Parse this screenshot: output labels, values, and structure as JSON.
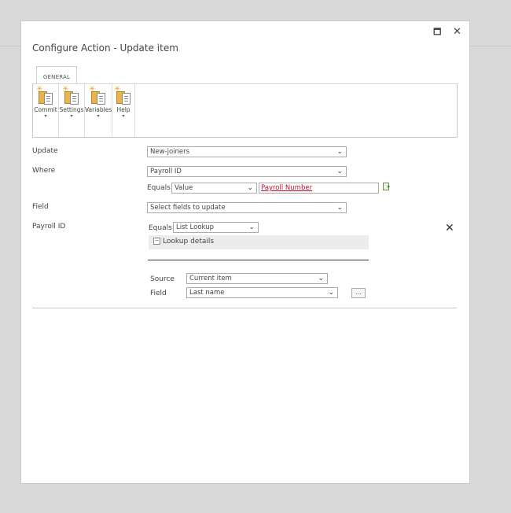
{
  "dialog": {
    "title": "Configure Action - Update item",
    "maximize_glyph": "🗖",
    "close_glyph": "✕"
  },
  "ribbon": {
    "tab_label": "GENERAL",
    "buttons": [
      {
        "label": "Commit",
        "icon": "commit-icon"
      },
      {
        "label": "Settings",
        "icon": "settings-icon"
      },
      {
        "label": "Variables",
        "icon": "variables-icon"
      },
      {
        "label": "Help",
        "icon": "help-icon"
      }
    ]
  },
  "form": {
    "update_label": "Update",
    "update_value": "New-joiners",
    "where_label": "Where",
    "where_value": "Payroll ID",
    "where_equals_label": "Equals",
    "where_equals_value": "Value",
    "where_reference": "Payroll Number",
    "field_label": "Field",
    "field_value": "Select fields to update",
    "payroll_label": "Payroll ID",
    "payroll_equals_label": "Equals",
    "payroll_equals_value": "List Lookup",
    "lookup_collapse_glyph": "−",
    "lookup_details_label": "Lookup details",
    "source_label": "Source",
    "source_value": "Current item",
    "lookup_field_label": "Field",
    "lookup_field_value": "Last name",
    "dots_label": "...",
    "remove_glyph": "✕"
  }
}
